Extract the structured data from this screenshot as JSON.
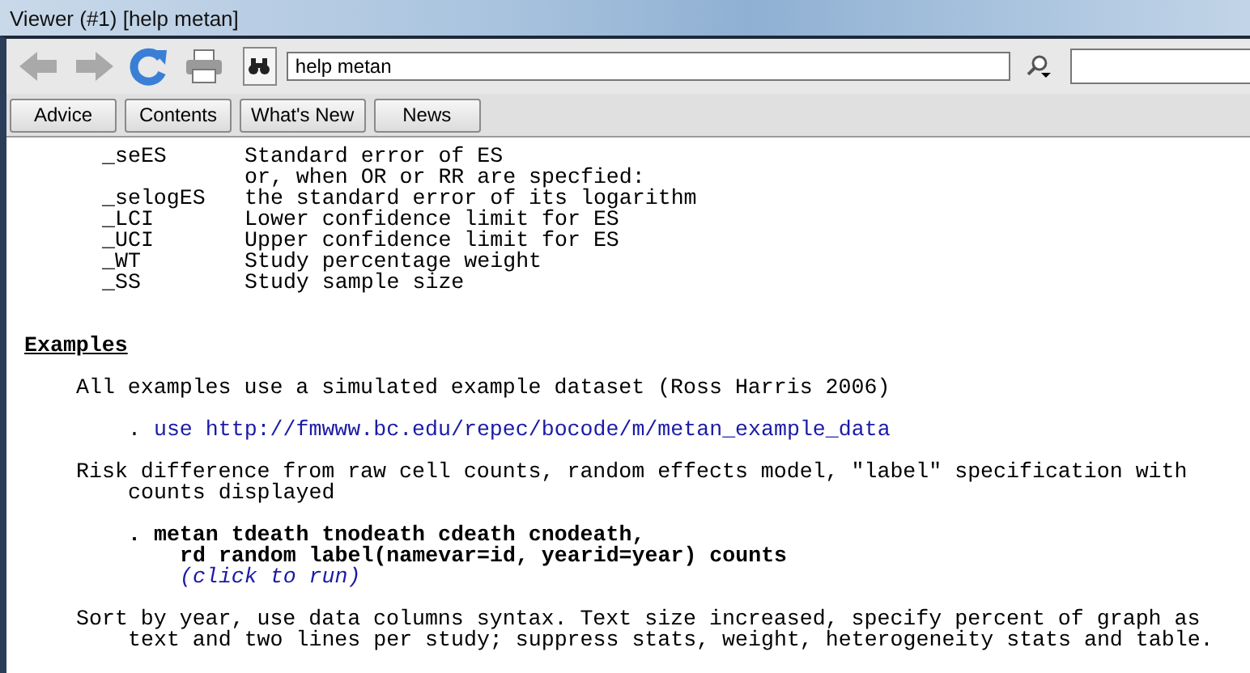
{
  "window": {
    "title": "Viewer (#1) [help metan]"
  },
  "toolbar": {
    "command": "help metan"
  },
  "nav_buttons": [
    "Advice",
    "Contents",
    "What's New",
    "News"
  ],
  "content": [
    {
      "kind": "var",
      "name": "_seES",
      "text": "Standard error of ES"
    },
    {
      "kind": "var",
      "text": "or, when OR or RR are specfied:"
    },
    {
      "kind": "var",
      "name": "_selogES",
      "text": "the standard error of its logarithm"
    },
    {
      "kind": "var",
      "name": "_LCI",
      "text": "Lower confidence limit for ES"
    },
    {
      "kind": "var",
      "name": "_UCI",
      "text": "Upper confidence limit for ES"
    },
    {
      "kind": "var",
      "name": "_WT",
      "text": "Study percentage weight"
    },
    {
      "kind": "var",
      "name": "_SS",
      "text": "Study sample size"
    },
    {
      "kind": "heading",
      "text": "Examples"
    },
    {
      "kind": "para",
      "lines": [
        "All examples use a simulated example dataset (Ross Harris 2006)"
      ]
    },
    {
      "kind": "link",
      "prefix": ".",
      "text": "use http://fmwww.bc.edu/repec/bocode/m/metan_example_data"
    },
    {
      "kind": "para",
      "lines": [
        "Risk difference from raw cell counts, random effects model, \"label\" specification with",
        "counts displayed"
      ]
    },
    {
      "kind": "command",
      "prefix": ".",
      "lines": [
        "metan tdeath tnodeath cdeath cnodeath,",
        "rd random label(namevar=id, yearid=year) counts"
      ]
    },
    {
      "kind": "run",
      "text": "(click to run)"
    },
    {
      "kind": "para",
      "lines": [
        "Sort by year, use data columns syntax. Text size increased, specify percent of graph as",
        "text and two lines per study; suppress stats, weight, heterogeneity stats and table."
      ]
    }
  ]
}
